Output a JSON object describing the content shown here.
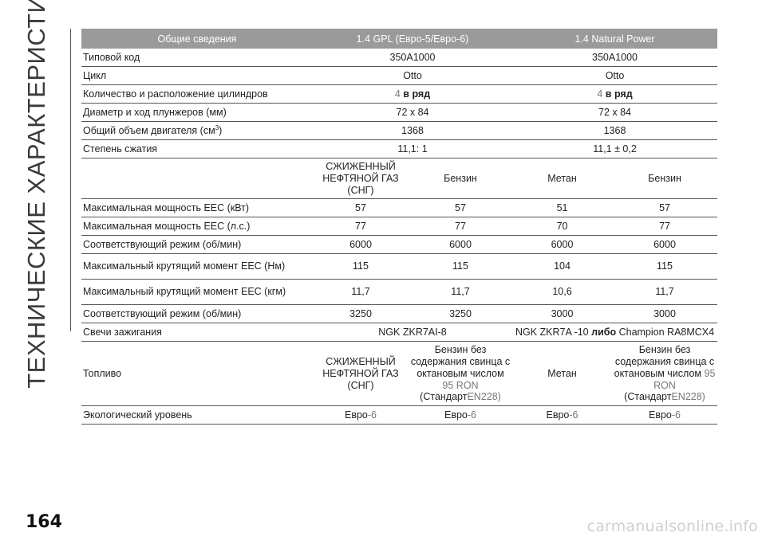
{
  "side_title": "ТЕХНИЧЕСКИЕ ХАРАКТЕРИСТИКИ",
  "page_number": "164",
  "watermark": "carmanualsonline.info",
  "header": {
    "col1": "Общие сведения",
    "col2": "1.4 GPL (Евро-5/Евро-6)",
    "col3": "1.4 Natural Power"
  },
  "rows": {
    "type_code": {
      "label": "Типовой код",
      "v1": "350A1000",
      "v2": "350A1000"
    },
    "cycle": {
      "label": "Цикл",
      "v1": "Otto",
      "v2": "Otto"
    },
    "cylinders": {
      "label": "Количество и расположение цилиндров",
      "n1": "4",
      "t1": "в ряд",
      "n2": "4",
      "t2": "в ряд"
    },
    "bore_stroke": {
      "label": "Диаметр и ход плунжеров (мм)",
      "v1": "72 x 84",
      "v2": "72 x 84"
    },
    "displacement": {
      "label_main": "Общий объем двигателя (см",
      "label_sup": "3",
      "label_end": ")",
      "v1": "1368",
      "v2": "1368"
    },
    "compression": {
      "label": "Степень сжатия",
      "v1": "11,1: 1",
      "v2": "11,1 ± 0,2"
    },
    "fuel_header": {
      "c1": "СЖИЖЕННЫЙ НЕФТЯНОЙ ГАЗ (СНГ)",
      "c2": "Бензин",
      "c3": "Метан",
      "c4": "Бензин"
    },
    "power_kw": {
      "label": "Максимальная мощность ЕЕС (кВт)",
      "v": [
        "57",
        "57",
        "51",
        "57"
      ]
    },
    "power_hp": {
      "label": "Максимальная мощность ЕЕС (л.с.)",
      "v": [
        "77",
        "77",
        "70",
        "77"
      ]
    },
    "power_rpm": {
      "label": "Соответствующий режим (об/мин)",
      "v": [
        "6000",
        "6000",
        "6000",
        "6000"
      ]
    },
    "torque_nm": {
      "label": "Максимальный крутящий момент ЕЕС (Нм)",
      "v": [
        "115",
        "115",
        "104",
        "115"
      ]
    },
    "torque_kgm": {
      "label": "Максимальный крутящий момент ЕЕС (кгм)",
      "v": [
        "11,7",
        "11,7",
        "10,6",
        "11,7"
      ]
    },
    "torque_rpm": {
      "label": "Соответствующий режим (об/мин)",
      "v": [
        "3250",
        "3250",
        "3000",
        "3000"
      ]
    },
    "spark_plugs": {
      "label": "Свечи зажигания",
      "v1": "NGK ZKR7AI-8",
      "v2_a": "NGK ZKR7A -10",
      "v2_b": "либо",
      "v2_c": "Champion RA8MCX4"
    },
    "fuel": {
      "label": "Топливо",
      "c1": "СЖИЖЕННЫЙ НЕФТЯНОЙ ГАЗ (СНГ)",
      "c2_a": "Бензин без содержания свинца с октановым",
      "c2_b": "числом",
      "c2_c": "95 RON",
      "c2_d": "(Стандарт",
      "c2_e": "EN228)",
      "c3": "Метан",
      "c4_a": "Бензин без содержания свинца с октановым",
      "c4_b": "числом",
      "c4_c": "95 RON",
      "c4_d": "(Стандарт",
      "c4_e": "EN228)"
    },
    "emissions": {
      "label": "Экологический уровень",
      "a": "Евро",
      "b": "-6"
    }
  }
}
